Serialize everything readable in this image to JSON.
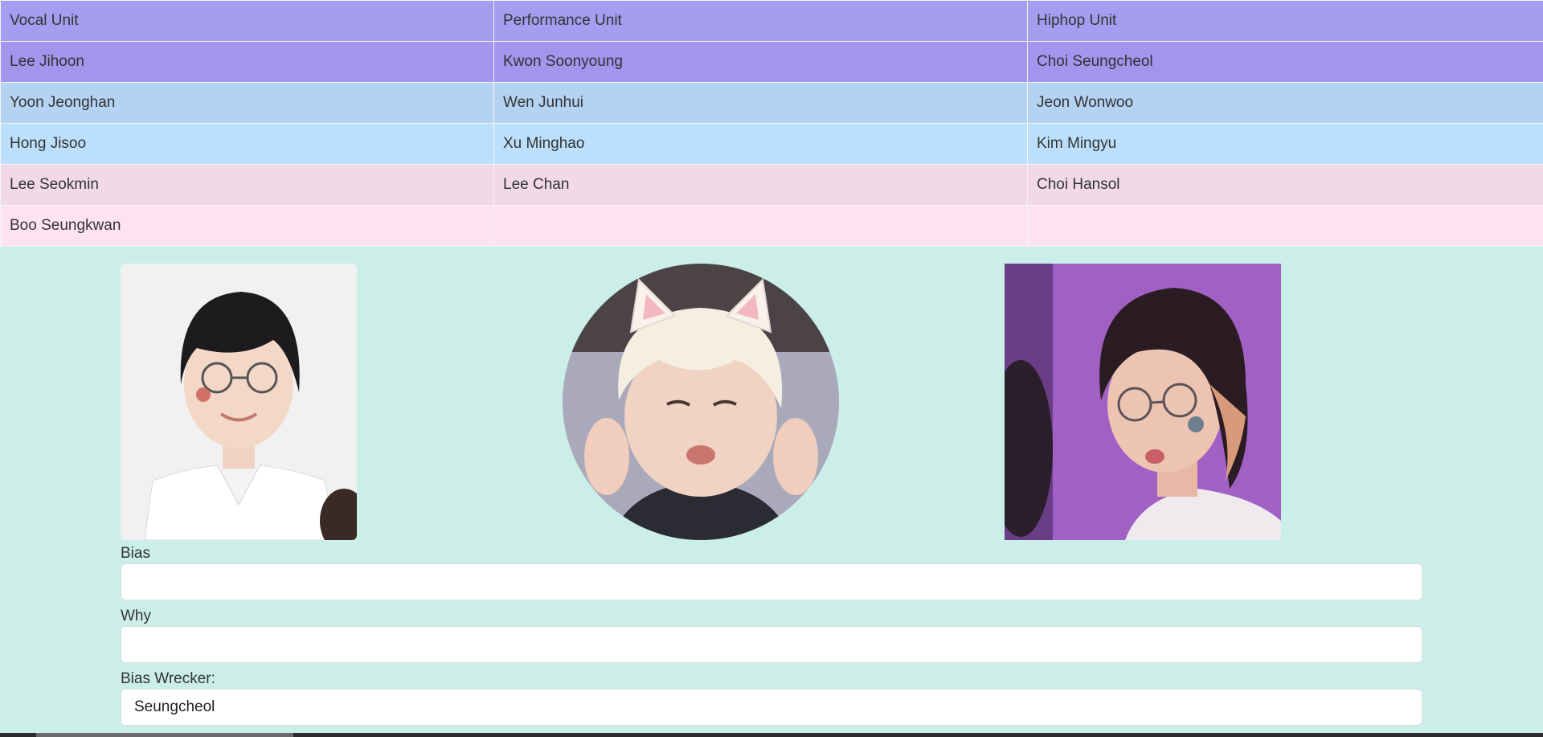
{
  "table": {
    "rows": [
      [
        "Vocal Unit",
        "Performance Unit",
        "Hiphop Unit"
      ],
      [
        "Lee Jihoon",
        "Kwon Soonyoung",
        "Choi Seungcheol"
      ],
      [
        "Yoon Jeonghan",
        "Wen Junhui",
        "Jeon Wonwoo"
      ],
      [
        "Hong Jisoo",
        "Xu Minghao",
        "Kim Mingyu"
      ],
      [
        "Lee Seokmin",
        "Lee Chan",
        "Choi Hansol"
      ],
      [
        "Boo Seungkwan",
        "",
        ""
      ]
    ],
    "row_colors": [
      "#a59df0",
      "#a195ee",
      "#b4d3f2",
      "#bce0fb",
      "#f1d9e6",
      "#fde3f2"
    ]
  },
  "page_background": "#cbefe8",
  "photos": [
    {
      "icon": "member-photo-icon",
      "shape": "rounded-rectangle"
    },
    {
      "icon": "member-photo-icon",
      "shape": "circle"
    },
    {
      "icon": "member-photo-icon",
      "shape": "rectangle"
    }
  ],
  "form": {
    "bias_label": "Bias",
    "bias_value": "",
    "why_label": "Why",
    "why_value": "",
    "wrecker_label": "Bias Wrecker:",
    "wrecker_value": "Seungcheol"
  }
}
